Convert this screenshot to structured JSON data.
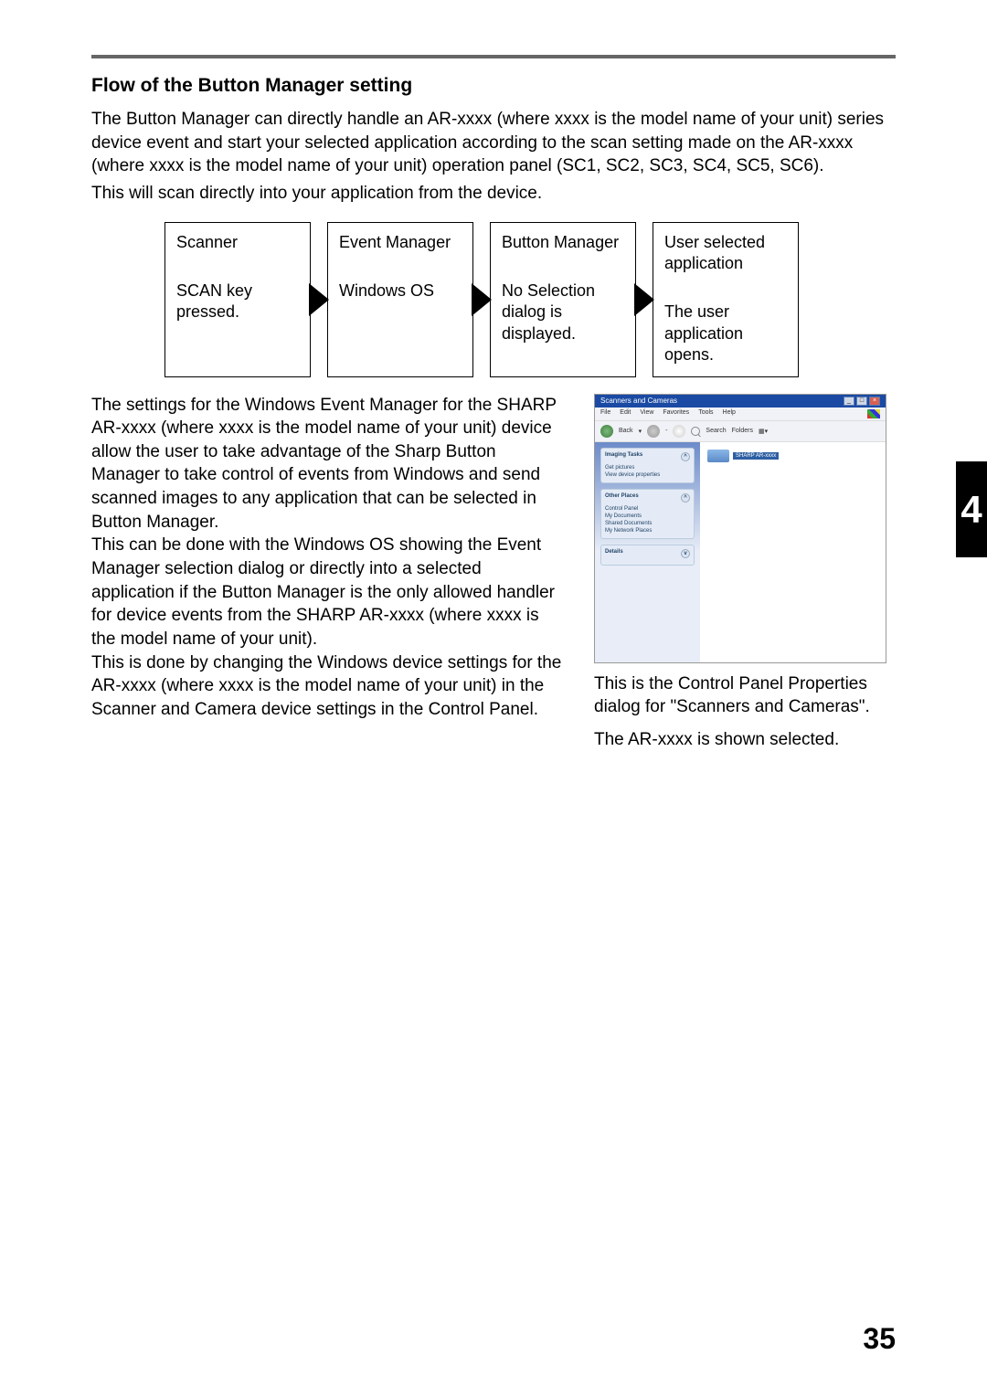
{
  "section_title": "Flow of the Button Manager setting",
  "intro_para": "The Button Manager can directly handle an AR-xxxx (where xxxx is the model name of your unit) series device event and start your selected application according to the scan setting made on the AR-xxxx (where xxxx is the model name of your unit) operation panel (SC1, SC2, SC3, SC4, SC5, SC6).",
  "intro_para2": "This will scan directly into your application from the device.",
  "flow": {
    "box1_top": "Scanner",
    "box1_bottom": "SCAN key pressed.",
    "box2_top": "Event Manager",
    "box2_bottom": "Windows OS",
    "box3_top": "Button Manager",
    "box3_bottom": "No Selection dialog is displayed.",
    "box4_top": "User selected application",
    "box4_bottom": "The user application opens."
  },
  "left_para1": "The settings for the Windows Event Manager for the SHARP AR-xxxx (where xxxx is the model name of your unit) device allow the user to take advantage of the Sharp Button Manager to take control of events from Windows and send scanned images to any application that can be selected in Button Manager.",
  "left_para2": "This can be done with the Windows OS showing the Event Manager selection dialog or directly into a selected application if the Button Manager is the only allowed handler for device events from the SHARP AR-xxxx (where xxxx is the model name of your unit).",
  "left_para3": "This is done by changing the Windows device settings for the AR-xxxx (where xxxx is the model name of your unit) in the Scanner and Camera device settings in the Control Panel.",
  "screenshot": {
    "title": "Scanners and Cameras",
    "menu": {
      "file": "File",
      "edit": "Edit",
      "view": "View",
      "favorites": "Favorites",
      "tools": "Tools",
      "help": "Help"
    },
    "toolbar": {
      "back": "Back",
      "search": "Search",
      "folders": "Folders"
    },
    "side1_header": "Imaging Tasks",
    "side1_item1": "Get pictures",
    "side1_item2": "View device properties",
    "side2_header": "Other Places",
    "side2_item1": "Control Panel",
    "side2_item2": "My Documents",
    "side2_item3": "Shared Documents",
    "side2_item4": "My Network Places",
    "side3_header": "Details",
    "device_label": "SHARP AR-xxxx"
  },
  "caption1": "This is the Control Panel Properties dialog for \"Scanners and Cameras\".",
  "caption2": "The AR-xxxx is shown selected.",
  "chapter_number": "4",
  "page_number": "35"
}
